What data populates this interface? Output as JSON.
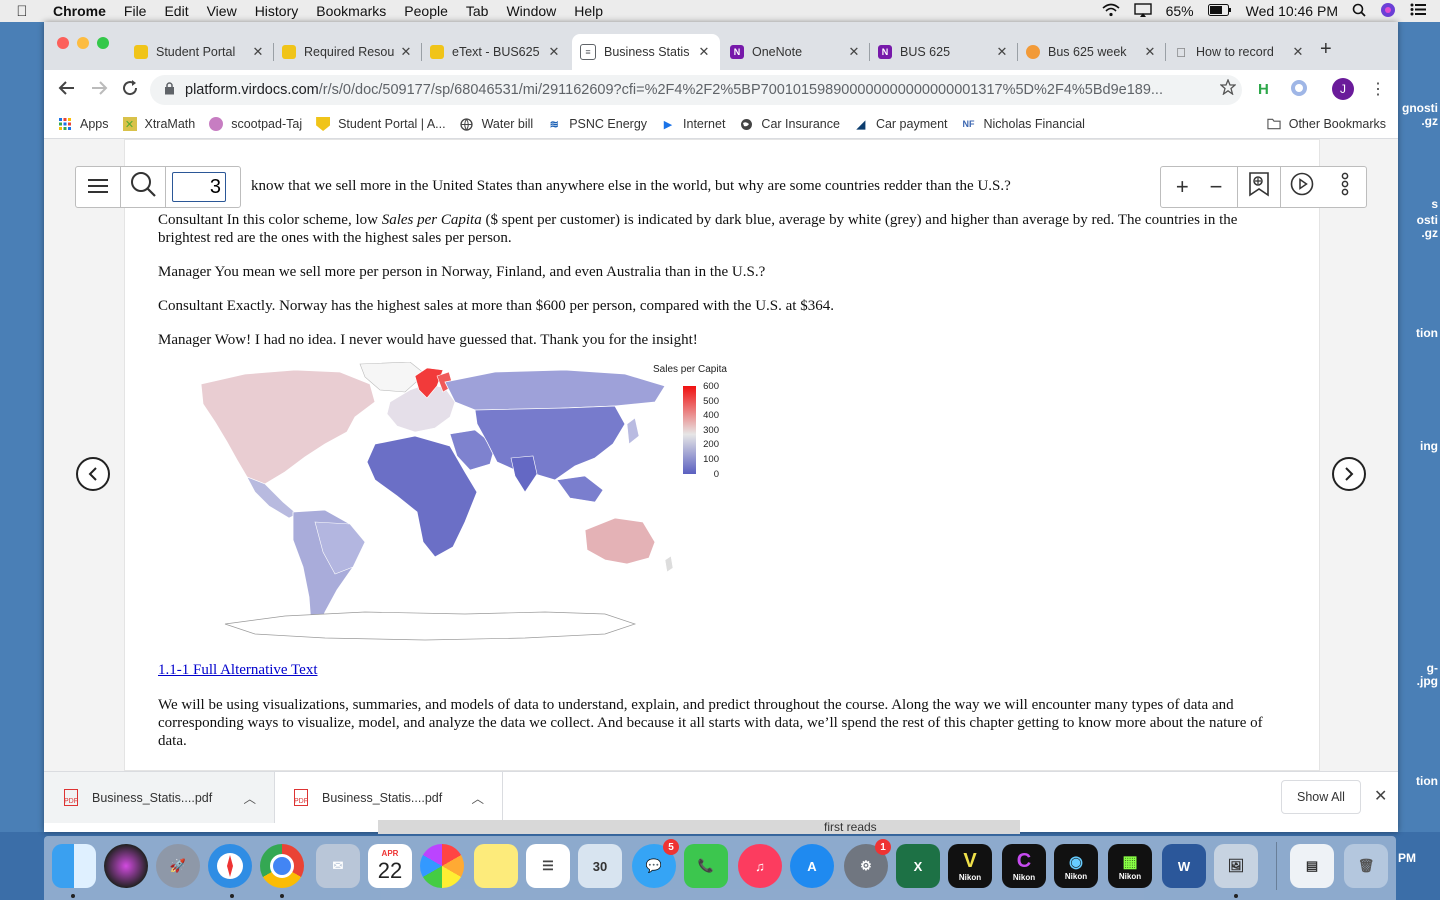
{
  "menubar": {
    "app": "Chrome",
    "items": [
      "File",
      "Edit",
      "View",
      "History",
      "Bookmarks",
      "People",
      "Tab",
      "Window",
      "Help"
    ],
    "battery": "65%",
    "clock": "Wed 10:46 PM"
  },
  "desktop": {
    "labels": [
      "gnosti\n.gz",
      "osti\n.gz",
      "s",
      "tion",
      "ing",
      "g-\n.jpg",
      "tion",
      "PM"
    ]
  },
  "tabs": [
    {
      "label": "Student Portal",
      "fav": "#f0c419",
      "active": false
    },
    {
      "label": "Required Resou",
      "fav": "#f0c419",
      "active": false
    },
    {
      "label": "eText - BUS625",
      "fav": "#f0c419",
      "active": false
    },
    {
      "label": "Business Statis",
      "fav": "#5f6368",
      "active": true
    },
    {
      "label": "OneNote",
      "fav": "#7719aa",
      "active": false
    },
    {
      "label": "BUS 625",
      "fav": "#7719aa",
      "active": false
    },
    {
      "label": "Bus 625 week",
      "fav": "#f29a38",
      "active": false
    },
    {
      "label": "How to record",
      "fav": "#555555",
      "active": false
    }
  ],
  "omnibox": {
    "host": "platform.virdocs.com",
    "path": "/r/s/0/doc/509177/sp/68046531/mi/291162609?cfi=%2F4%2F2%5BP700101598900000000000000001317%5D%2F4%5Bd9e189..."
  },
  "profile_initial": "J",
  "bookmarks": [
    "Apps",
    "XtraMath",
    "scootpad-Taj",
    "Student Portal | A...",
    "Water bill",
    "PSNC Energy",
    "Internet",
    "Car Insurance",
    "Car payment",
    "Nicholas Financial"
  ],
  "other_bookmarks": "Other Bookmarks",
  "reader": {
    "page_number": "3",
    "top_line": "know that we sell more in the United States than anywhere else in the world, but why are some countries redder than the U.S.?"
  },
  "document": {
    "p1_prefix": "Consultant In this color scheme, low ",
    "p1_em": "Sales per Capita",
    "p1_suffix": " ($ spent per customer) is indicated by dark blue, average by white (grey) and higher than average by red. The countries in the brightest red are the ones with the highest sales per person.",
    "p2": "Manager You mean we sell more per person in Norway, Finland, and even Australia than in the U.S.?",
    "p3": "Consultant Exactly. Norway has the highest sales at more than $600 per person, compared with the U.S. at $364.",
    "p4": "Manager Wow! I had no idea. I never would have guessed that. Thank you for the insight!",
    "alt_link": "1.1-1 Full Alternative Text",
    "p5": "We will be using visualizations, summaries, and models of data to understand, explain, and predict throughout the course. Along the way we will encounter many types of data and corresponding ways to visualize, model, and analyze the data we collect. And because it all starts with data, we’ll spend the rest of this chapter getting to know more about the nature of data."
  },
  "map_legend": {
    "title": "Sales per Capita",
    "ticks": [
      "600",
      "500",
      "400",
      "300",
      "200",
      "100",
      "0"
    ],
    "low_color": "#5a5fc0",
    "mid_color": "#e6e6e6",
    "high_color": "#f01010"
  },
  "downloads": {
    "items": [
      "Business_Statis....pdf",
      "Business_Statis....pdf"
    ],
    "show_all": "Show All"
  },
  "behind_text": "first reads",
  "dock": {
    "calendar_month": "APR",
    "calendar_day": "22",
    "messages_badge": "5",
    "prefs_badge": "1",
    "nikon_label": "Nikon"
  }
}
